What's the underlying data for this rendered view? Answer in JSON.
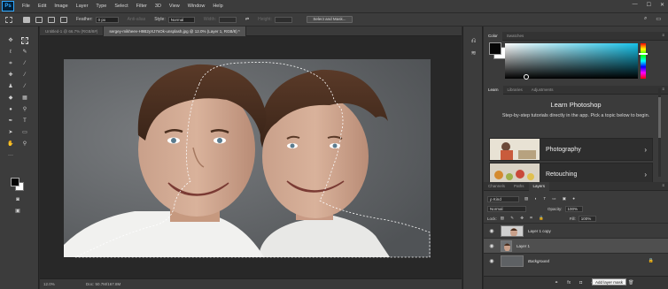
{
  "app": {
    "logo": "Ps"
  },
  "menu": [
    "File",
    "Edit",
    "Image",
    "Layer",
    "Type",
    "Select",
    "Filter",
    "3D",
    "View",
    "Window",
    "Help"
  ],
  "window_controls": [
    "—",
    "☐",
    "✕"
  ],
  "options": {
    "feather_label": "Feather:",
    "feather_value": "0 px",
    "antialias_label": "Anti-alias",
    "style_label": "Style:",
    "style_value": "Normal",
    "width_label": "Width:",
    "height_label": "Height:",
    "select_mask_label": "Select and Mask..."
  },
  "tabs": [
    {
      "label": "Untitled-1 @ 66.7% (RGB/8#)"
    },
    {
      "label": "sergey-mikheev-H9B2yXJ7sOk-unsplash.jpg @ 12.0% (Layer 1, RGB/8) *"
    }
  ],
  "status": {
    "zoom": "12.0%",
    "doc": "Doc: 50.7M/167.8M"
  },
  "panels": {
    "color_tabs": [
      "Color",
      "Swatches"
    ],
    "learn_tabs": [
      "Learn",
      "Libraries",
      "Adjustments"
    ],
    "learn_title": "Learn Photoshop",
    "learn_desc": "Step-by-step tutorials directly in the app. Pick a topic below to begin.",
    "cards": [
      {
        "label": "Photography"
      },
      {
        "label": "Retouching"
      }
    ],
    "layers_tabs": [
      "Channels",
      "Paths",
      "Layers"
    ],
    "kind_value": "ρ Kind",
    "blend_mode": "Normal",
    "opacity_label": "Opacity:",
    "opacity_value": "100%",
    "lock_label": "Lock:",
    "fill_label": "Fill:",
    "fill_value": "100%",
    "layers": [
      {
        "name": "Layer 1 copy",
        "italic": false
      },
      {
        "name": "Layer 1",
        "italic": false
      },
      {
        "name": "Background",
        "italic": true
      }
    ],
    "tooltip": "Add layer mask"
  },
  "colors": {
    "accent": "#31a8ff",
    "spectrum_hue": "#17c3ea",
    "foreground": "#050505",
    "background": "#ffffff"
  }
}
